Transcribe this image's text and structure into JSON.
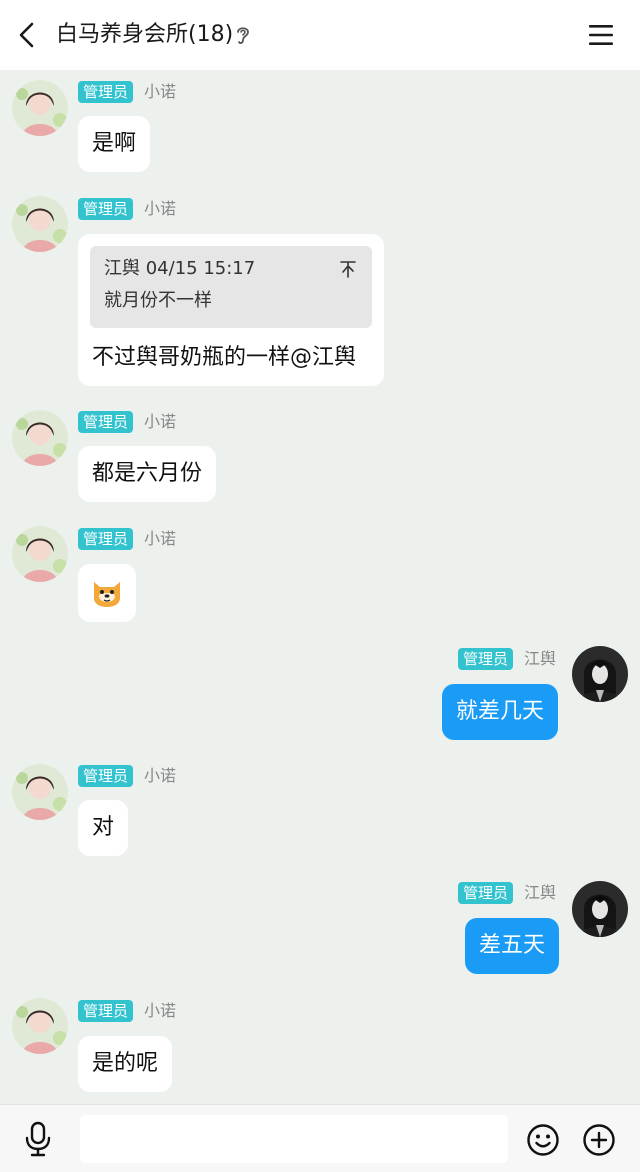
{
  "header": {
    "title": "白马养身会所(18)",
    "back_icon": "chevron-left-icon",
    "mode_icon": "ear-icon",
    "menu_icon": "hamburger-menu-icon"
  },
  "colors": {
    "badge": "#33c3cf",
    "my_bubble": "#1a9cf6",
    "background": "#edf1ee"
  },
  "messages": [
    {
      "side": "left",
      "badge": "管理员",
      "sender": "小诺",
      "text": "是啊"
    },
    {
      "side": "left",
      "badge": "管理员",
      "sender": "小诺",
      "quote": {
        "author_time": "江舆 04/15 15:17",
        "text": "就月份不一样"
      },
      "text": "不过舆哥奶瓶的一样@江舆"
    },
    {
      "side": "left",
      "badge": "管理员",
      "sender": "小诺",
      "text": "都是六月份"
    },
    {
      "side": "left",
      "badge": "管理员",
      "sender": "小诺",
      "text": "",
      "emoji": "doge-emoji"
    },
    {
      "side": "right",
      "badge": "管理员",
      "sender": "江舆",
      "text": "就差几天"
    },
    {
      "side": "left",
      "badge": "管理员",
      "sender": "小诺",
      "text": "对"
    },
    {
      "side": "right",
      "badge": "管理员",
      "sender": "江舆",
      "text": "差五天"
    },
    {
      "side": "left",
      "badge": "管理员",
      "sender": "小诺",
      "text": "是的呢"
    }
  ],
  "composer": {
    "value": "",
    "mic_icon": "microphone-icon",
    "emoji_icon": "smiley-icon",
    "plus_icon": "plus-circle-icon"
  }
}
